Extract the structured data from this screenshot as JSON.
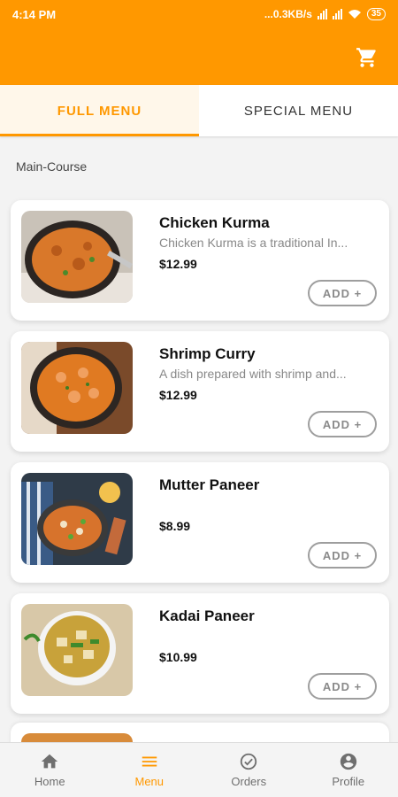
{
  "status_bar": {
    "time": "4:14 PM",
    "network_speed": "...0.3KB/s",
    "battery": "35"
  },
  "app_bar": {
    "cart_icon": "cart-icon"
  },
  "tabs": [
    {
      "label": "FULL MENU",
      "active": true
    },
    {
      "label": "SPECIAL MENU",
      "active": false
    }
  ],
  "section": {
    "label": "Main-Course"
  },
  "menu_items": [
    {
      "name": "Chicken Kurma",
      "description": "Chicken Kurma is a traditional In...",
      "price": "$12.99",
      "add_label": "ADD +"
    },
    {
      "name": "Shrimp Curry",
      "description": "A dish prepared with shrimp and...",
      "price": "$12.99",
      "add_label": "ADD +"
    },
    {
      "name": "Mutter Paneer",
      "description": "",
      "price": "$8.99",
      "add_label": "ADD +"
    },
    {
      "name": "Kadai Paneer",
      "description": "",
      "price": "$10.99",
      "add_label": "ADD +"
    }
  ],
  "bottom_nav": [
    {
      "label": "Home",
      "icon": "home-icon"
    },
    {
      "label": "Menu",
      "icon": "menu-icon",
      "active": true
    },
    {
      "label": "Orders",
      "icon": "check-circle-icon"
    },
    {
      "label": "Profile",
      "icon": "account-icon"
    }
  ],
  "colors": {
    "accent": "#ff9800"
  }
}
